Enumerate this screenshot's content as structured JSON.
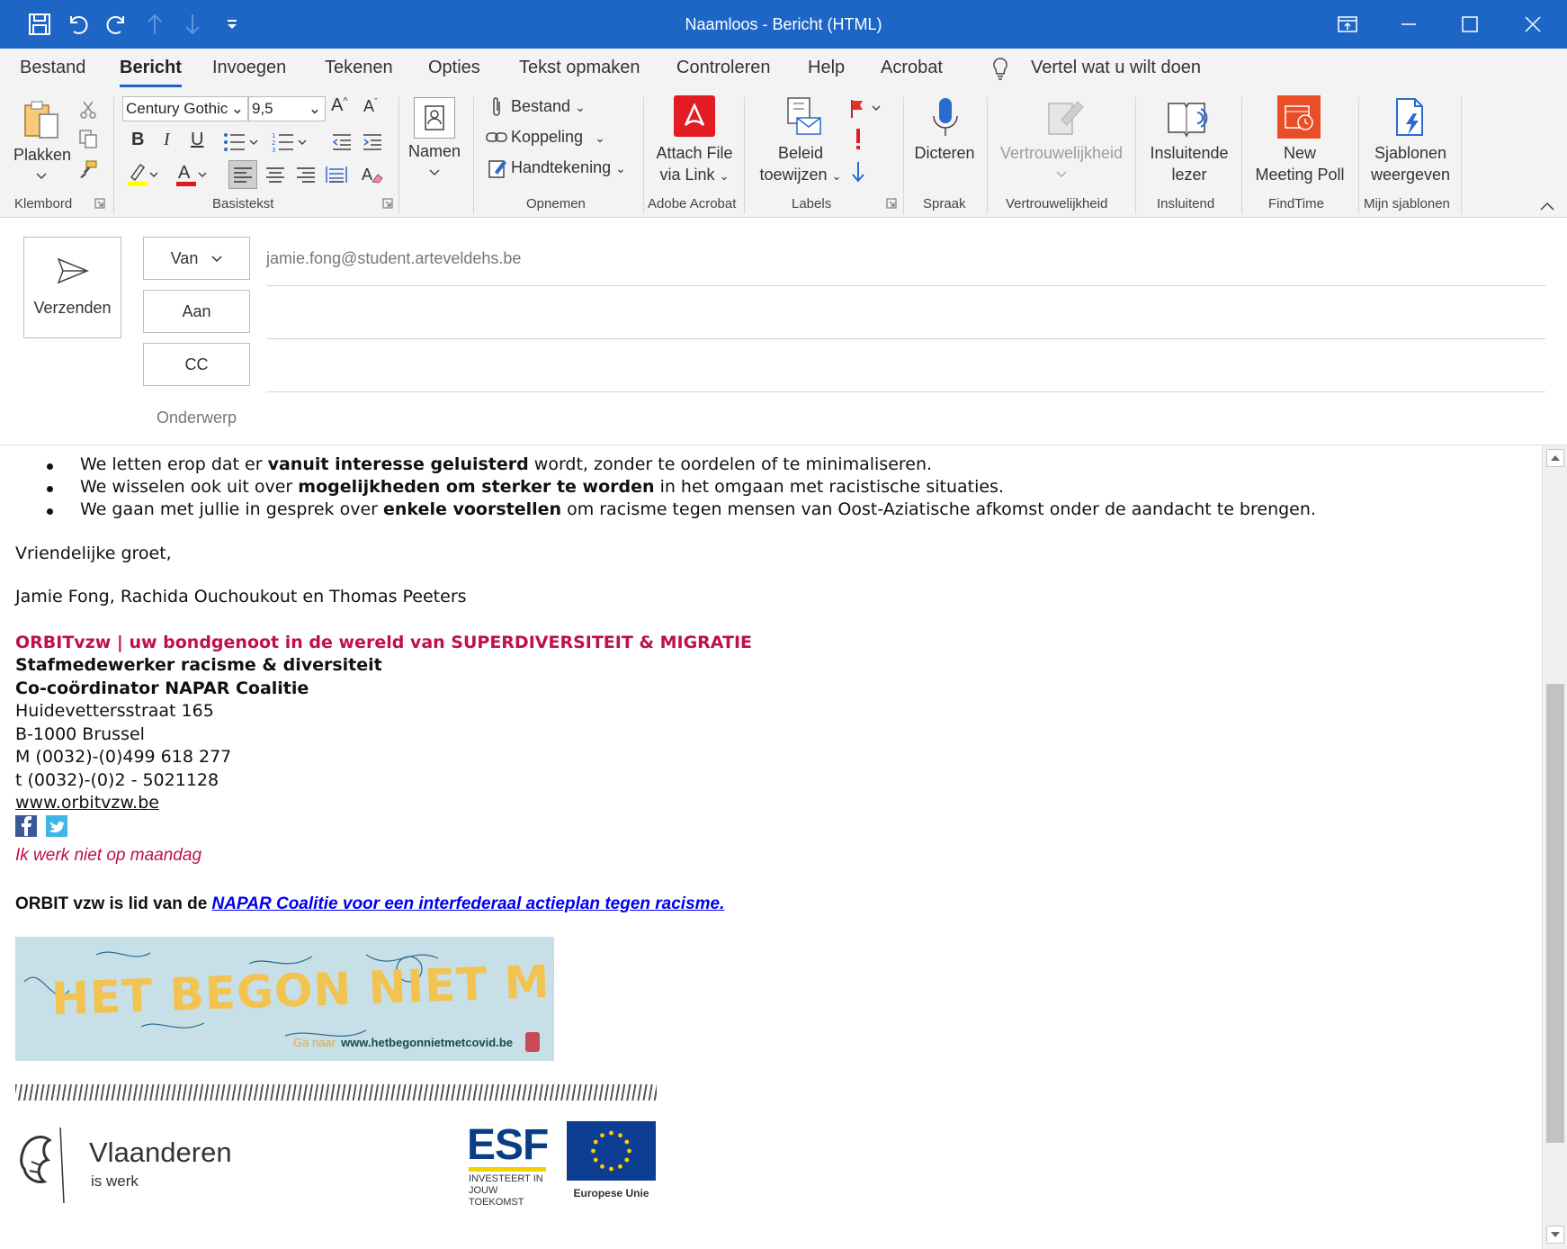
{
  "window": {
    "title": "Naamloos  -  Bericht (HTML)"
  },
  "menu": {
    "tabs": [
      "Bestand",
      "Bericht",
      "Invoegen",
      "Tekenen",
      "Opties",
      "Tekst opmaken",
      "Controleren",
      "Help",
      "Acrobat"
    ],
    "tell_me": "Vertel wat u wilt doen",
    "active_tab": "Bericht"
  },
  "ribbon": {
    "klembord": {
      "paste": "Plakken",
      "group": "Klembord"
    },
    "basistekst": {
      "font": "Century Gothic",
      "size": "9,5",
      "group": "Basistekst",
      "bold": "B",
      "italic": "I",
      "underline": "U"
    },
    "namen": {
      "label": "Namen"
    },
    "opnemen": {
      "bestand": "Bestand",
      "koppeling": "Koppeling",
      "handtekening": "Handtekening",
      "group": "Opnemen"
    },
    "acrobat": {
      "label1": "Attach File",
      "label2": "via Link",
      "group": "Adobe Acrobat"
    },
    "labels": {
      "label1": "Beleid",
      "label2": "toewijzen",
      "group": "Labels"
    },
    "spraak": {
      "label": "Dicteren",
      "group": "Spraak"
    },
    "vertrouwelijkheid": {
      "label": "Vertrouwelijkheid",
      "group": "Vertrouwelijkheid"
    },
    "insluitend": {
      "label1": "Insluitende",
      "label2": "lezer",
      "group": "Insluitend"
    },
    "findtime": {
      "label1": "New",
      "label2": "Meeting Poll",
      "group": "FindTime"
    },
    "sjablonen": {
      "label1": "Sjablonen",
      "label2": "weergeven",
      "group": "Mijn sjablonen"
    }
  },
  "compose": {
    "send": "Verzenden",
    "from_button": "Van",
    "from_address": "jamie.fong@student.arteveldehs.be",
    "to_button": "Aan",
    "cc_button": "CC",
    "subject_label": "Onderwerp"
  },
  "message": {
    "bullets": [
      {
        "pre": "We letten erop dat er ",
        "bold": "vanuit interesse geluisterd",
        "post": " wordt, zonder te oordelen of te minimaliseren."
      },
      {
        "pre": "We wisselen ook uit over ",
        "bold": "mogelijkheden om sterker te worden",
        "post": " in het omgaan met racistische situaties."
      },
      {
        "pre": "We gaan met jullie in gesprek over ",
        "bold": "enkele voorstellen",
        "post": " om racisme tegen mensen van Oost-Aziatische afkomst onder de aandacht te brengen."
      }
    ],
    "greeting": "Vriendelijke groet,",
    "names": "Jamie Fong, Rachida Ouchoukout en Thomas Peeters"
  },
  "signature": {
    "tagline": "ORBITvzw | uw bondgenoot in de wereld van SUPERDIVERSITEIT & MIGRATIE",
    "role1": "Stafmedewerker racisme & diversiteit",
    "role2": "Co-coördinator NAPAR Coalitie",
    "street": "Huidevettersstraat 165",
    "city": "B-1000 Brussel",
    "mobile": "M  (0032)-(0)499 618 277",
    "phone": "t    (0032)-(0)2 - 5021128",
    "website": "www.orbitvzw.be",
    "availability": "Ik werk niet op maandag",
    "member_pre": "ORBIT vzw is lid van de ",
    "member_link": "NAPAR Coalitie voor een interfederaal actieplan tegen racisme."
  },
  "banner": {
    "headline": "HET BEGON NIET MET COVID",
    "go_to": "Ga naar",
    "url": "www.hetbegonnietmetcovid.be"
  },
  "logos": {
    "vlaanderen": "Vlaanderen",
    "vlaanderen_sub": "is werk",
    "esf": "ESF",
    "esf_sub1": "INVESTEERT IN",
    "esf_sub2": "JOUW TOEKOMST",
    "eu": "Europese Unie"
  },
  "colors": {
    "titlebar": "#1e66c6",
    "accent_red": "#c0104a",
    "link": "#0000ee"
  }
}
